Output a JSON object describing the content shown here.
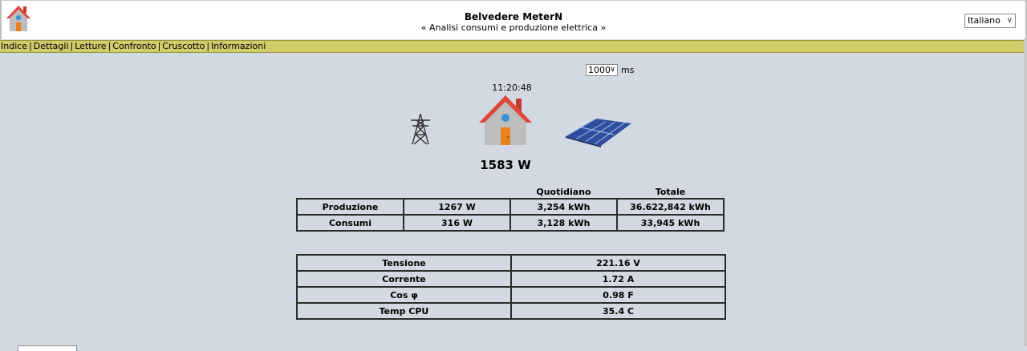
{
  "header": {
    "title": "Belvedere MeterN",
    "subtitle": "« Analisi consumi e produzione elettrica »",
    "language": "Italiano"
  },
  "menu": [
    "Indice",
    "Dettagli",
    "Letture",
    "Confronto",
    "Cruscotto",
    "Informazioni"
  ],
  "menu_separator": "|",
  "refresh": {
    "value": "1000",
    "unit": "ms"
  },
  "clock": "11:20:48",
  "power": "1583 W",
  "energy_table": {
    "headers": [
      "",
      "",
      "Quotidiano",
      "Totale"
    ],
    "rows": [
      [
        "Produzione",
        "1267 W",
        "3,254 kWh",
        "36.622,842 kWh"
      ],
      [
        "Consumi",
        "316 W",
        "3,128 kWh",
        "33,945 kWh"
      ]
    ]
  },
  "status_table": {
    "rows": [
      [
        "Tensione",
        "221.16 V"
      ],
      [
        "Corrente",
        "1.72 A"
      ],
      [
        "Cos φ",
        "0.98 F"
      ],
      [
        "Temp CPU",
        "35.4 C"
      ]
    ]
  },
  "icons": [
    "house-icon",
    "pylon-icon",
    "solar-panel-icon",
    "chevron-down-icon"
  ],
  "colors": {
    "menu_bar": "#cfcc6a",
    "background": "#d3d9e2",
    "roof": "#e0473c",
    "door": "#e8821e"
  }
}
